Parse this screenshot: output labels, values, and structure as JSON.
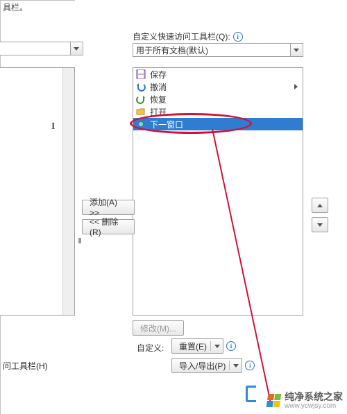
{
  "partial_top_label": "具栏。",
  "section_label": "自定义快速访问工具栏(Q):",
  "left_truncated_dd": "",
  "target_dd": {
    "selected": "用于所有文档(默认)"
  },
  "list": {
    "items": [
      {
        "icon": "save",
        "label": "保存"
      },
      {
        "icon": "undo",
        "label": "撤消",
        "has_more": true
      },
      {
        "icon": "redo",
        "label": "恢复"
      },
      {
        "icon": "open",
        "label": "打开"
      },
      {
        "icon": "dot",
        "label": "下一窗口",
        "selected": true
      }
    ]
  },
  "buttons": {
    "add": "添加(A) >>",
    "remove": "<< 删除(R)",
    "modify": "修改(M)...",
    "reset_label": "自定义:",
    "reset": "重置(E)",
    "import_export": "导入/导出(P)"
  },
  "footer_link": "问工具栏(H)",
  "watermark": {
    "text": "纯净系统之家",
    "url": "www.ycwjsy.com"
  }
}
